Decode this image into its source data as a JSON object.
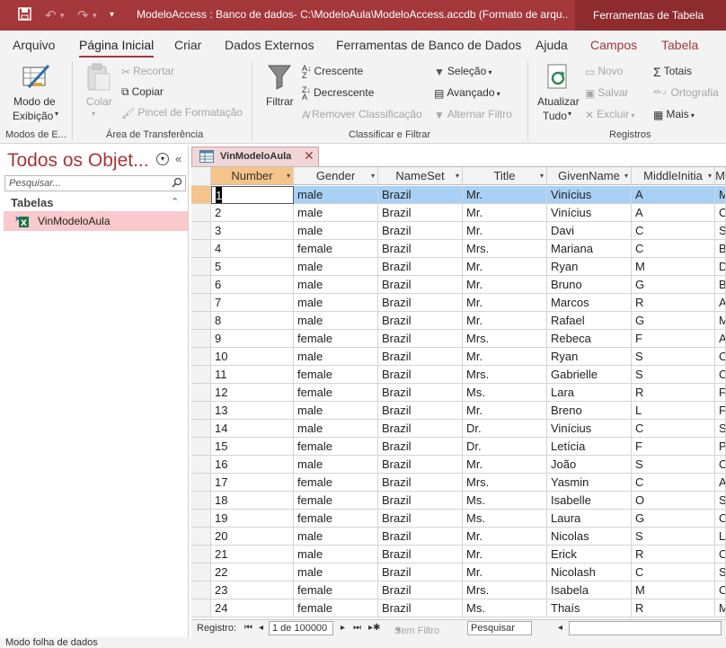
{
  "titlebar": {
    "title": "ModeloAccess : Banco de dados- C:\\ModeloAula\\ModeloAccess.accdb (Formato de arqu...",
    "context_tools": "Ferramentas de Tabela"
  },
  "tabs": {
    "arquivo": "Arquivo",
    "pagina_inicial": "Página Inicial",
    "criar": "Criar",
    "dados_externos": "Dados Externos",
    "ferramentas_bd": "Ferramentas de Banco de Dados",
    "ajuda": "Ajuda",
    "campos": "Campos",
    "tabela": "Tabela"
  },
  "ribbon": {
    "modo_exibicao_1": "Modo de",
    "modo_exibicao_2": "Exibição",
    "grp_modos": "Modos de E...",
    "colar": "Colar",
    "recortar": "Recortar",
    "copiar": "Copiar",
    "pincel": "Pincel de Formatação",
    "grp_transferencia": "Área de Transferência",
    "filtrar": "Filtrar",
    "crescente": "Crescente",
    "decrescente": "Decrescente",
    "remover": "Remover Classificação",
    "selecao": "Seleção",
    "avancado": "Avançado",
    "alternar": "Alternar Filtro",
    "grp_classificar": "Classificar e Filtrar",
    "atualizar_1": "Atualizar",
    "atualizar_2": "Tudo",
    "novo": "Novo",
    "salvar": "Salvar",
    "excluir": "Excluir",
    "totais": "Totais",
    "ortografia": "Ortografia",
    "mais": "Mais",
    "grp_registros": "Registros"
  },
  "nav": {
    "heading": "Todos os Objet...",
    "search_placeholder": "Pesquisar...",
    "section": "Tabelas",
    "items": [
      "VinModeloAula"
    ]
  },
  "doc_tab": {
    "label": "VinModeloAula"
  },
  "table": {
    "columns": [
      "Number",
      "Gender",
      "NameSet",
      "Title",
      "GivenName",
      "MiddleInitia",
      "M"
    ],
    "rows": [
      [
        "1",
        "male",
        "Brazil",
        "Mr.",
        "Vinícius",
        "A",
        "M"
      ],
      [
        "2",
        "male",
        "Brazil",
        "Mr.",
        "Vinícius",
        "A",
        "C"
      ],
      [
        "3",
        "male",
        "Brazil",
        "Mr.",
        "Davi",
        "C",
        "S"
      ],
      [
        "4",
        "female",
        "Brazil",
        "Mrs.",
        "Mariana",
        "C",
        "B"
      ],
      [
        "5",
        "male",
        "Brazil",
        "Mr.",
        "Ryan",
        "M",
        "D"
      ],
      [
        "6",
        "male",
        "Brazil",
        "Mr.",
        "Bruno",
        "G",
        "B"
      ],
      [
        "7",
        "male",
        "Brazil",
        "Mr.",
        "Marcos",
        "R",
        "A"
      ],
      [
        "8",
        "male",
        "Brazil",
        "Mr.",
        "Rafael",
        "G",
        "M"
      ],
      [
        "9",
        "female",
        "Brazil",
        "Mrs.",
        "Rebeca",
        "F",
        "A"
      ],
      [
        "10",
        "male",
        "Brazil",
        "Mr.",
        "Ryan",
        "S",
        "C"
      ],
      [
        "11",
        "female",
        "Brazil",
        "Mrs.",
        "Gabrielle",
        "S",
        "C"
      ],
      [
        "12",
        "female",
        "Brazil",
        "Ms.",
        "Lara",
        "R",
        "F"
      ],
      [
        "13",
        "male",
        "Brazil",
        "Mr.",
        "Breno",
        "L",
        "F"
      ],
      [
        "14",
        "male",
        "Brazil",
        "Dr.",
        "Vinícius",
        "C",
        "S"
      ],
      [
        "15",
        "female",
        "Brazil",
        "Dr.",
        "Letícia",
        "F",
        "P"
      ],
      [
        "16",
        "male",
        "Brazil",
        "Mr.",
        "João",
        "S",
        "C"
      ],
      [
        "17",
        "female",
        "Brazil",
        "Mrs.",
        "Yasmin",
        "C",
        "A"
      ],
      [
        "18",
        "female",
        "Brazil",
        "Ms.",
        "Isabelle",
        "O",
        "S"
      ],
      [
        "19",
        "female",
        "Brazil",
        "Ms.",
        "Laura",
        "G",
        "C"
      ],
      [
        "20",
        "male",
        "Brazil",
        "Mr.",
        "Nicolas",
        "S",
        "L"
      ],
      [
        "21",
        "male",
        "Brazil",
        "Mr.",
        "Erick",
        "R",
        "C"
      ],
      [
        "22",
        "male",
        "Brazil",
        "Mr.",
        "Nicolash",
        "C",
        "S"
      ],
      [
        "23",
        "female",
        "Brazil",
        "Mrs.",
        "Isabela",
        "M",
        "C"
      ],
      [
        "24",
        "female",
        "Brazil",
        "Ms.",
        "Thaís",
        "R",
        "M"
      ]
    ]
  },
  "recnav": {
    "label": "Registro:",
    "position": "1 de 100000",
    "filter": "Sem Filtro",
    "search": "Pesquisar"
  },
  "status": {
    "text": "Modo folha de dados"
  },
  "colors": {
    "accent": "#a4373a",
    "selected_row": "#a9d0f5",
    "header_selected": "#f5c48a",
    "nav_item": "#f9c9cb"
  }
}
